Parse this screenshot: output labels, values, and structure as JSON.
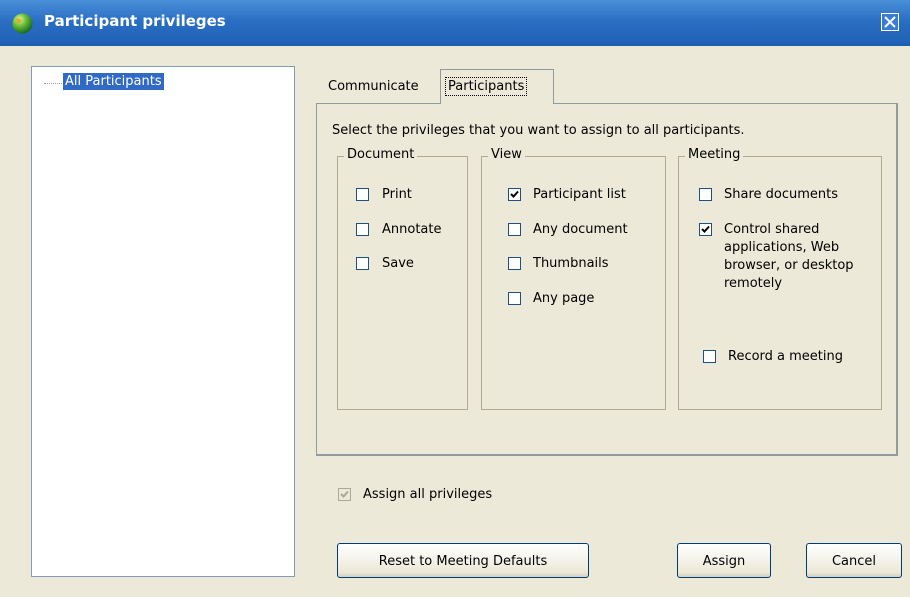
{
  "window": {
    "title": "Participant privileges",
    "close_icon": "close-icon"
  },
  "tree": {
    "items": [
      {
        "label": "All Participants",
        "selected": true
      }
    ]
  },
  "tabs": [
    {
      "label": "Communicate",
      "active": false
    },
    {
      "label": "Participants",
      "active": true
    }
  ],
  "panel": {
    "instructions": "Select the privileges that you want to assign to all participants.",
    "groups": {
      "document": {
        "title": "Document",
        "items": [
          {
            "label": "Print",
            "checked": false
          },
          {
            "label": "Annotate",
            "checked": false
          },
          {
            "label": "Save",
            "checked": false
          }
        ]
      },
      "view": {
        "title": "View",
        "items": [
          {
            "label": "Participant list",
            "checked": true
          },
          {
            "label": "Any document",
            "checked": false
          },
          {
            "label": "Thumbnails",
            "checked": false
          },
          {
            "label": "Any page",
            "checked": false
          }
        ]
      },
      "meeting": {
        "title": "Meeting",
        "items": [
          {
            "label": "Share documents",
            "checked": false
          },
          {
            "label": "Control shared applications, Web browser, or desktop remotely",
            "checked": true
          },
          {
            "label": "Record a meeting",
            "checked": false
          }
        ]
      }
    }
  },
  "assign_all": {
    "label": "Assign all privileges",
    "checked": true,
    "disabled": true
  },
  "buttons": {
    "reset": "Reset to Meeting Defaults",
    "assign": "Assign",
    "cancel": "Cancel"
  },
  "colors": {
    "titlebar": "#2a6fc4",
    "selection": "#316ac5",
    "dialog_bg": "#ece9d8"
  }
}
